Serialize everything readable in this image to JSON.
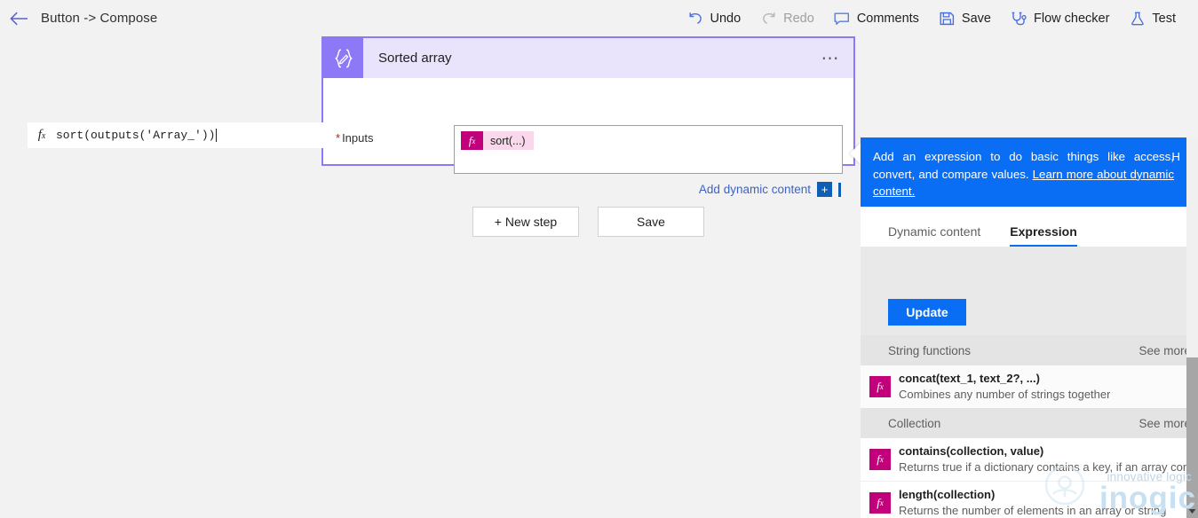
{
  "commandbar": {
    "back_icon": "back-arrow-icon",
    "flow_title": "Button -> Compose",
    "actions": [
      {
        "label": "Undo",
        "icon": "undo-icon",
        "disabled": false
      },
      {
        "label": "Redo",
        "icon": "redo-icon",
        "disabled": true
      },
      {
        "label": "Comments",
        "icon": "comment-icon",
        "disabled": false
      },
      {
        "label": "Save",
        "icon": "save-disk-icon",
        "disabled": false
      },
      {
        "label": "Flow checker",
        "icon": "stethoscope-icon",
        "disabled": false
      },
      {
        "label": "Test",
        "icon": "flask-icon",
        "disabled": false
      }
    ]
  },
  "compose_card": {
    "icon": "compose-braces-pencil-icon",
    "title": "Sorted array",
    "overflow_icon": "ellipsis-icon",
    "inputs_label": "Inputs",
    "required_marker": "*",
    "token": {
      "fx_glyph": "f",
      "fx_sub": "x",
      "text": "sort(...)"
    },
    "add_dynamic_content": "Add dynamic content",
    "add_dynamic_plus": "+",
    "header_bg": "#e9e3fb",
    "border_color": "#8d79f6"
  },
  "canvas_buttons": {
    "new_step": "+ New step",
    "save": "Save"
  },
  "panel": {
    "banner": {
      "text_before_link": "Add an expression to do basic things like access, convert, and compare values. ",
      "link_text": "Learn more about dynamic content.",
      "edge_text": "H",
      "bg": "#0a6ef5"
    },
    "tabs": [
      {
        "label": "Dynamic content",
        "active": false
      },
      {
        "label": "Expression",
        "active": true
      }
    ],
    "expression_input": {
      "fx_glyph": "f",
      "fx_sub": "x",
      "value": "sort(outputs('Array_'))"
    },
    "update_button": "Update",
    "groups": [
      {
        "name": "String functions",
        "see_more": "See more",
        "items": [
          {
            "icon": "fx-icon",
            "signature": "concat(text_1, text_2?, ...)",
            "description": "Combines any number of strings together"
          }
        ]
      },
      {
        "name": "Collection",
        "see_more": "See more",
        "items": [
          {
            "icon": "fx-icon",
            "signature": "contains(collection, value)",
            "description": "Returns true if a dictionary contains a key, if an array cont"
          },
          {
            "icon": "fx-icon",
            "signature": "length(collection)",
            "description": "Returns the number of elements in an array or string"
          }
        ]
      }
    ],
    "scrollbar": {
      "name": "panel-scrollbar",
      "down_arrow": "▾"
    }
  },
  "watermark": {
    "tagline": "innovative logic",
    "wordmark": "inogic"
  }
}
